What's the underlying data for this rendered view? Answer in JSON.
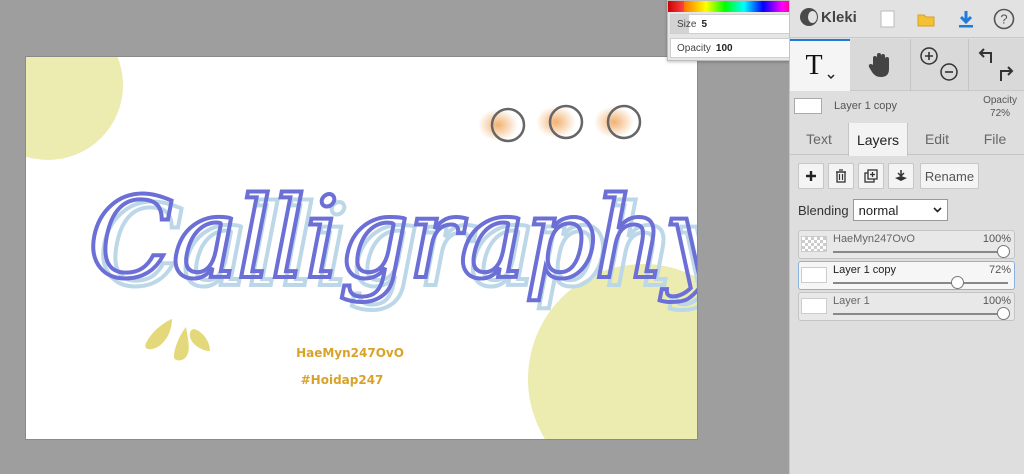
{
  "canvas": {
    "title": "Calligraphy",
    "handle": "HaeMyn247OvO",
    "hashtag": "#Hoidap247",
    "colors": {
      "accent_blue": "#6b6fd6",
      "shadow_blue": "#bcd7e8",
      "pale_yellow": "#ecebb0",
      "mustard": "#d9a228",
      "orange": "#f0b27a"
    }
  },
  "brush": {
    "size_label": "Size",
    "size_value": "5",
    "size_fraction": 0.14,
    "opacity_label": "Opacity",
    "opacity_value": "100",
    "opacity_fraction": 1.0
  },
  "app": {
    "name": "Kleki"
  },
  "topbar_icons": [
    "new-image-icon",
    "folder-icon",
    "download-icon",
    "help-icon"
  ],
  "tools": {
    "text_glyph": "T"
  },
  "current_layer": {
    "name": "Layer 1 copy",
    "opacity_label": "Opacity",
    "opacity_value": "72%"
  },
  "tabs": [
    {
      "label": "Text",
      "active": false
    },
    {
      "label": "Layers",
      "active": true
    },
    {
      "label": "Edit",
      "active": false
    },
    {
      "label": "File",
      "active": false
    }
  ],
  "layer_actions": {
    "rename_label": "Rename"
  },
  "blending": {
    "label": "Blending",
    "value": "normal"
  },
  "layers": [
    {
      "name": "HaeMyn247OvO",
      "opacity": "100%",
      "opacity_fraction": 1.0,
      "active": false
    },
    {
      "name": "Layer 1 copy",
      "opacity": "72%",
      "opacity_fraction": 0.72,
      "active": true
    },
    {
      "name": "Layer 1",
      "opacity": "100%",
      "opacity_fraction": 1.0,
      "active": false
    }
  ]
}
